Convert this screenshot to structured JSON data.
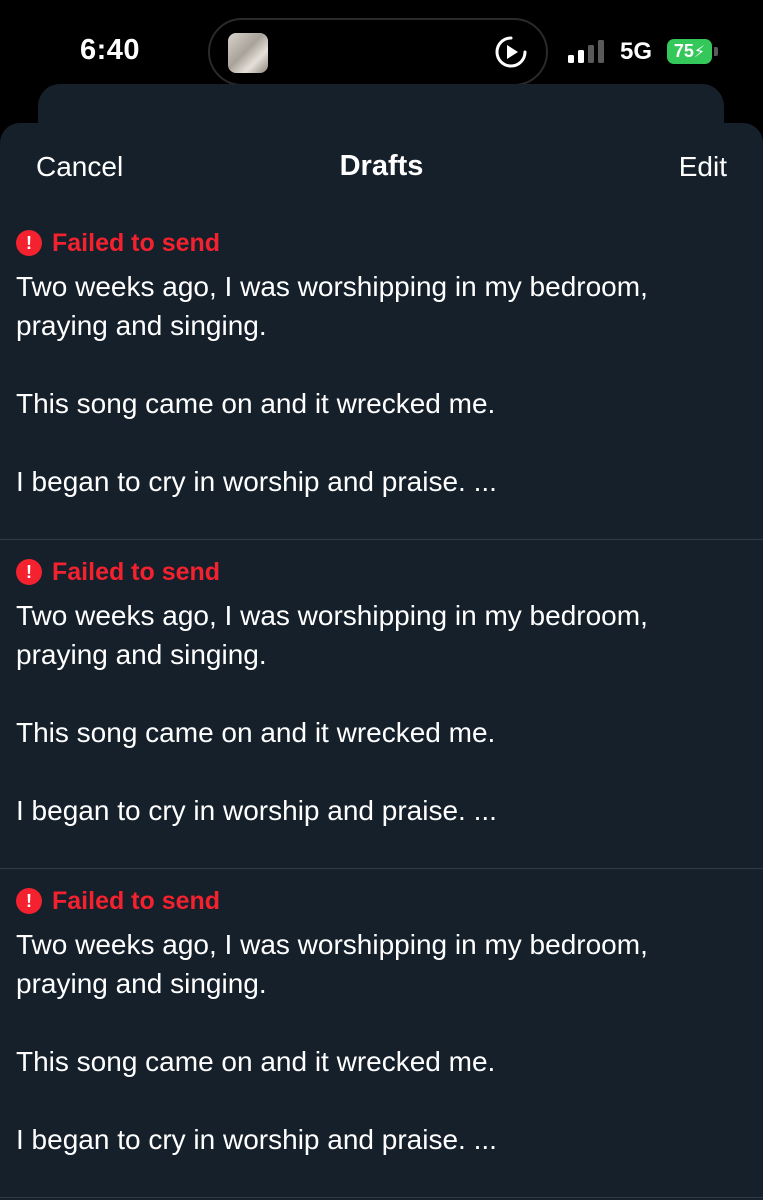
{
  "status_bar": {
    "time": "6:40",
    "network": "5G",
    "battery": "75",
    "battery_color": "#34c759"
  },
  "header": {
    "cancel_label": "Cancel",
    "title": "Drafts",
    "edit_label": "Edit"
  },
  "drafts": [
    {
      "status": "Failed to send",
      "line1": "Two weeks ago, I was worshipping in my bedroom,",
      "line2": "praying and singing.",
      "line3": "This song came on and it wrecked me.",
      "line4": "I began to cry in worship and praise. ..."
    },
    {
      "status": "Failed to send",
      "line1": "Two weeks ago, I was worshipping in my bedroom,",
      "line2": "praying and singing.",
      "line3": "This song came on and it wrecked me.",
      "line4": "I began to cry in worship and praise. ..."
    },
    {
      "status": "Failed to send",
      "line1": "Two weeks ago, I was worshipping in my bedroom,",
      "line2": "praying and singing.",
      "line3": "This song came on and it wrecked me.",
      "line4": "I began to cry in worship and praise. ..."
    }
  ],
  "colors": {
    "background": "#15202b",
    "error": "#f4212e"
  }
}
